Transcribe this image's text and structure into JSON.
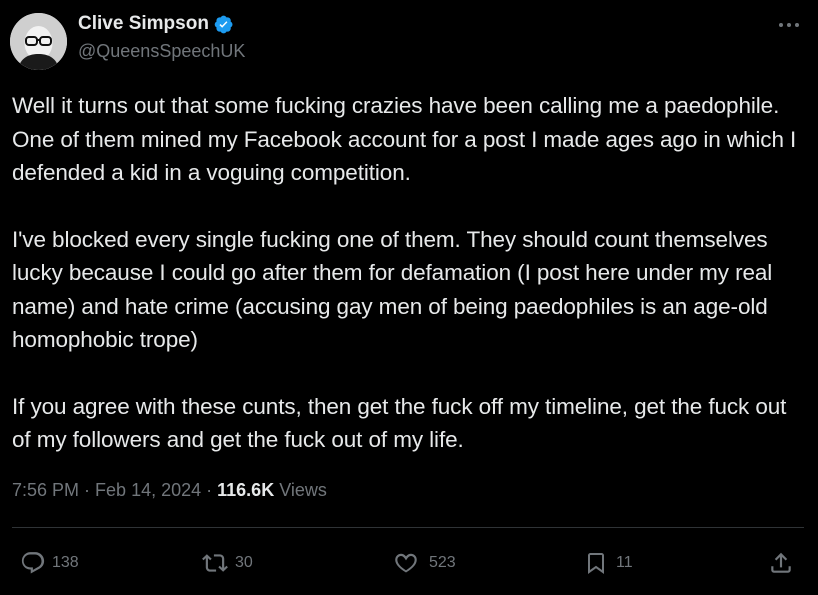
{
  "author": {
    "display_name": "Clive Simpson",
    "handle": "@QueensSpeechUK",
    "verified": true
  },
  "tweet": {
    "paragraphs": [
      "Well it turns out that some fucking crazies have been calling me a paedophile. One of them mined my Facebook account for a post I made ages ago in which I defended a kid in a voguing competition.",
      "I've blocked every single fucking one of them. They should count themselves lucky because I could go after them for defamation (I post here under my real name) and hate crime (accusing gay men of being paedophiles is an age-old homophobic trope)",
      "If you agree with these cunts, then get the fuck off my timeline, get the fuck out of my followers and get the fuck out of my life."
    ],
    "time": "7:56 PM",
    "date": "Feb 14, 2024",
    "separator": "·",
    "views_count": "116.6K",
    "views_label": "Views"
  },
  "actions": {
    "replies": "138",
    "reposts": "30",
    "likes": "523",
    "bookmarks": "11"
  },
  "colors": {
    "background": "#000000",
    "text": "#e7e9ea",
    "muted": "#71767b",
    "verified": "#1d9bf0",
    "divider": "#2f3336"
  },
  "icons": [
    "more-icon",
    "verified-icon",
    "reply-icon",
    "repost-icon",
    "like-icon",
    "bookmark-icon",
    "share-icon"
  ]
}
